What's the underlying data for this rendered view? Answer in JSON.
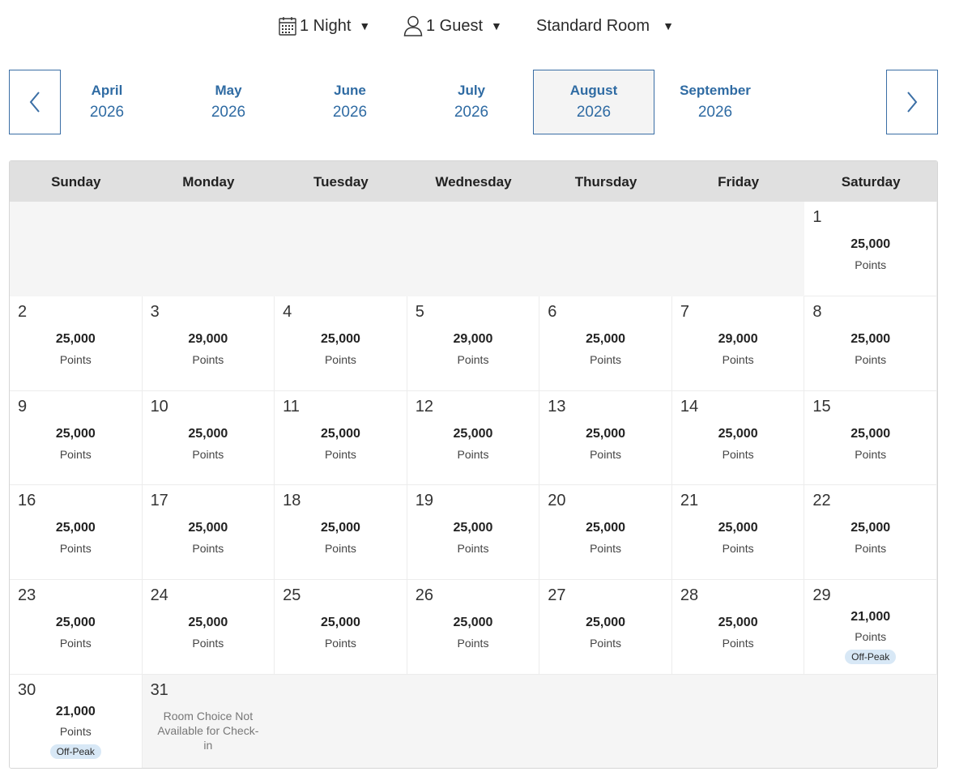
{
  "filters": {
    "nights": {
      "label": "1 Night"
    },
    "guests": {
      "label": "1 Guest"
    },
    "room": {
      "label": "Standard Room"
    },
    "caret": "▼"
  },
  "months": [
    {
      "name": "April",
      "year": "2026",
      "selected": false
    },
    {
      "name": "May",
      "year": "2026",
      "selected": false
    },
    {
      "name": "June",
      "year": "2026",
      "selected": false
    },
    {
      "name": "July",
      "year": "2026",
      "selected": false
    },
    {
      "name": "August",
      "year": "2026",
      "selected": true
    },
    {
      "name": "September",
      "year": "2026",
      "selected": false
    }
  ],
  "weekdays": [
    "Sunday",
    "Monday",
    "Tuesday",
    "Wednesday",
    "Thursday",
    "Friday",
    "Saturday"
  ],
  "points_label": "Points",
  "offpeak_label": "Off-Peak",
  "unavailable_text": "Room Choice Not Available for Check-in",
  "leading_blank_days": 6,
  "days": [
    {
      "day": "1",
      "points": "25,000"
    },
    {
      "day": "2",
      "points": "25,000"
    },
    {
      "day": "3",
      "points": "29,000"
    },
    {
      "day": "4",
      "points": "25,000"
    },
    {
      "day": "5",
      "points": "29,000"
    },
    {
      "day": "6",
      "points": "25,000"
    },
    {
      "day": "7",
      "points": "29,000"
    },
    {
      "day": "8",
      "points": "25,000"
    },
    {
      "day": "9",
      "points": "25,000"
    },
    {
      "day": "10",
      "points": "25,000"
    },
    {
      "day": "11",
      "points": "25,000"
    },
    {
      "day": "12",
      "points": "25,000"
    },
    {
      "day": "13",
      "points": "25,000"
    },
    {
      "day": "14",
      "points": "25,000"
    },
    {
      "day": "15",
      "points": "25,000"
    },
    {
      "day": "16",
      "points": "25,000"
    },
    {
      "day": "17",
      "points": "25,000"
    },
    {
      "day": "18",
      "points": "25,000"
    },
    {
      "day": "19",
      "points": "25,000"
    },
    {
      "day": "20",
      "points": "25,000"
    },
    {
      "day": "21",
      "points": "25,000"
    },
    {
      "day": "22",
      "points": "25,000"
    },
    {
      "day": "23",
      "points": "25,000"
    },
    {
      "day": "24",
      "points": "25,000"
    },
    {
      "day": "25",
      "points": "25,000"
    },
    {
      "day": "26",
      "points": "25,000"
    },
    {
      "day": "27",
      "points": "25,000"
    },
    {
      "day": "28",
      "points": "25,000"
    },
    {
      "day": "29",
      "points": "21,000",
      "offpeak": true
    },
    {
      "day": "30",
      "points": "21,000",
      "offpeak": true
    },
    {
      "day": "31",
      "points": null,
      "unavailable": true
    }
  ],
  "colors": {
    "accent": "#2f6ba3",
    "badge_bg": "#d8e8f6",
    "header_bg": "#e0e0e0"
  }
}
